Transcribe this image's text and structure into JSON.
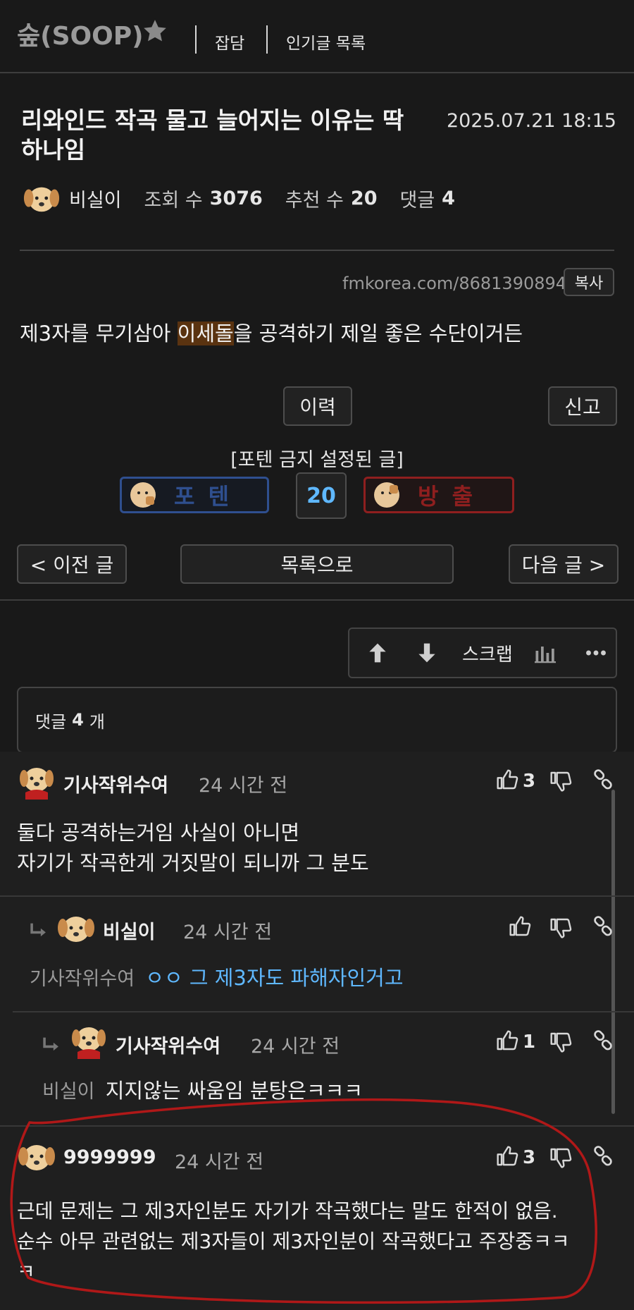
{
  "header": {
    "board_title": "숲(SOOP)",
    "nav": [
      "잡담",
      "인기글 목록"
    ]
  },
  "post": {
    "title_line1": "리와인드 작곡 물고 늘어지는 이유는 딱",
    "title_line2": "하나임",
    "date": "2025.07.21 18:15",
    "author": "비실이",
    "views_label": "조회 수",
    "views": "3076",
    "recommend_label": "추천 수",
    "recommends": "20",
    "comments_label": "댓글",
    "comments": "4",
    "url": "fmkorea.com/8681390894",
    "copy_label": "복사",
    "body_before": "제3자를 무기삼아 ",
    "body_highlight": "이세돌",
    "body_after": "을 공격하기 제일 좋은 수단이거든",
    "history_label": "이력",
    "report_label": "신고",
    "potten_notice": "[포텐 금지 설정된 글]",
    "vote_up_label": "포 텐",
    "vote_count": "20",
    "vote_down_label": "방 출"
  },
  "nav_buttons": {
    "prev": "< 이전 글",
    "list": "목록으로",
    "next": "다음 글 >"
  },
  "toolbar": {
    "scrap": "스크랩"
  },
  "comments_header": {
    "prefix": "댓글",
    "count": "4",
    "suffix": "개"
  },
  "comments": [
    {
      "author": "기사작위수여",
      "time": "24 시간 전",
      "likes": "3",
      "line1": "둘다 공격하는거임 사실이 아니면",
      "line2": "자기가 작곡한게 거짓말이 되니까 그 분도"
    },
    {
      "author": "비실이",
      "time": "24 시간 전",
      "likes": "",
      "mention": "기사작위수여",
      "text": "ㅇㅇ 그 제3자도 파해자인거고"
    },
    {
      "author": "기사작위수여",
      "time": "24 시간 전",
      "likes": "1",
      "mention": "비실이",
      "text": "지지않는 싸움임 분탕은ㅋㅋㅋ"
    },
    {
      "author": "9999999",
      "time": "24 시간 전",
      "likes": "3",
      "line1": "근데 문제는 그 제3자인분도 자기가 작곡했다는 말도 한적이 없음.",
      "line2": "순수 아무 관련없는 제3자들이 제3자인분이 작곡했다고 주장중ㅋㅋ",
      "line3": "ㅋ"
    }
  ],
  "colors": {
    "background": "#191919",
    "reply_link": "#5fb8ff",
    "highlight_bg": "#5a3310",
    "potten_blue": "#2f4f8f",
    "bangchul_red": "#8f1f1f",
    "vote_count": "#5fb8ff",
    "annotation_red": "#b01818"
  }
}
